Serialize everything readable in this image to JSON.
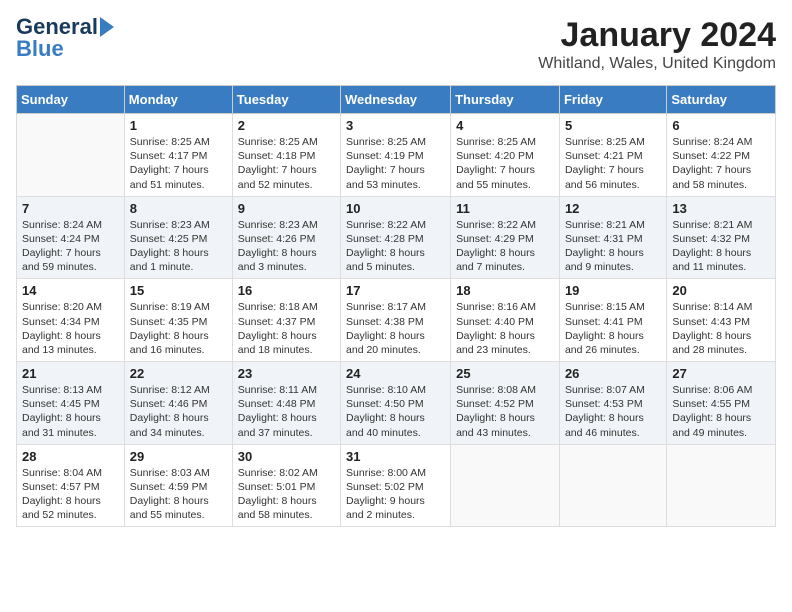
{
  "logo": {
    "text1": "General",
    "text2": "Blue"
  },
  "title": "January 2024",
  "location": "Whitland, Wales, United Kingdom",
  "days_of_week": [
    "Sunday",
    "Monday",
    "Tuesday",
    "Wednesday",
    "Thursday",
    "Friday",
    "Saturday"
  ],
  "weeks": [
    {
      "shaded": false,
      "days": [
        {
          "num": "",
          "sunrise": "",
          "sunset": "",
          "daylight": ""
        },
        {
          "num": "1",
          "sunrise": "Sunrise: 8:25 AM",
          "sunset": "Sunset: 4:17 PM",
          "daylight": "Daylight: 7 hours and 51 minutes."
        },
        {
          "num": "2",
          "sunrise": "Sunrise: 8:25 AM",
          "sunset": "Sunset: 4:18 PM",
          "daylight": "Daylight: 7 hours and 52 minutes."
        },
        {
          "num": "3",
          "sunrise": "Sunrise: 8:25 AM",
          "sunset": "Sunset: 4:19 PM",
          "daylight": "Daylight: 7 hours and 53 minutes."
        },
        {
          "num": "4",
          "sunrise": "Sunrise: 8:25 AM",
          "sunset": "Sunset: 4:20 PM",
          "daylight": "Daylight: 7 hours and 55 minutes."
        },
        {
          "num": "5",
          "sunrise": "Sunrise: 8:25 AM",
          "sunset": "Sunset: 4:21 PM",
          "daylight": "Daylight: 7 hours and 56 minutes."
        },
        {
          "num": "6",
          "sunrise": "Sunrise: 8:24 AM",
          "sunset": "Sunset: 4:22 PM",
          "daylight": "Daylight: 7 hours and 58 minutes."
        }
      ]
    },
    {
      "shaded": true,
      "days": [
        {
          "num": "7",
          "sunrise": "Sunrise: 8:24 AM",
          "sunset": "Sunset: 4:24 PM",
          "daylight": "Daylight: 7 hours and 59 minutes."
        },
        {
          "num": "8",
          "sunrise": "Sunrise: 8:23 AM",
          "sunset": "Sunset: 4:25 PM",
          "daylight": "Daylight: 8 hours and 1 minute."
        },
        {
          "num": "9",
          "sunrise": "Sunrise: 8:23 AM",
          "sunset": "Sunset: 4:26 PM",
          "daylight": "Daylight: 8 hours and 3 minutes."
        },
        {
          "num": "10",
          "sunrise": "Sunrise: 8:22 AM",
          "sunset": "Sunset: 4:28 PM",
          "daylight": "Daylight: 8 hours and 5 minutes."
        },
        {
          "num": "11",
          "sunrise": "Sunrise: 8:22 AM",
          "sunset": "Sunset: 4:29 PM",
          "daylight": "Daylight: 8 hours and 7 minutes."
        },
        {
          "num": "12",
          "sunrise": "Sunrise: 8:21 AM",
          "sunset": "Sunset: 4:31 PM",
          "daylight": "Daylight: 8 hours and 9 minutes."
        },
        {
          "num": "13",
          "sunrise": "Sunrise: 8:21 AM",
          "sunset": "Sunset: 4:32 PM",
          "daylight": "Daylight: 8 hours and 11 minutes."
        }
      ]
    },
    {
      "shaded": false,
      "days": [
        {
          "num": "14",
          "sunrise": "Sunrise: 8:20 AM",
          "sunset": "Sunset: 4:34 PM",
          "daylight": "Daylight: 8 hours and 13 minutes."
        },
        {
          "num": "15",
          "sunrise": "Sunrise: 8:19 AM",
          "sunset": "Sunset: 4:35 PM",
          "daylight": "Daylight: 8 hours and 16 minutes."
        },
        {
          "num": "16",
          "sunrise": "Sunrise: 8:18 AM",
          "sunset": "Sunset: 4:37 PM",
          "daylight": "Daylight: 8 hours and 18 minutes."
        },
        {
          "num": "17",
          "sunrise": "Sunrise: 8:17 AM",
          "sunset": "Sunset: 4:38 PM",
          "daylight": "Daylight: 8 hours and 20 minutes."
        },
        {
          "num": "18",
          "sunrise": "Sunrise: 8:16 AM",
          "sunset": "Sunset: 4:40 PM",
          "daylight": "Daylight: 8 hours and 23 minutes."
        },
        {
          "num": "19",
          "sunrise": "Sunrise: 8:15 AM",
          "sunset": "Sunset: 4:41 PM",
          "daylight": "Daylight: 8 hours and 26 minutes."
        },
        {
          "num": "20",
          "sunrise": "Sunrise: 8:14 AM",
          "sunset": "Sunset: 4:43 PM",
          "daylight": "Daylight: 8 hours and 28 minutes."
        }
      ]
    },
    {
      "shaded": true,
      "days": [
        {
          "num": "21",
          "sunrise": "Sunrise: 8:13 AM",
          "sunset": "Sunset: 4:45 PM",
          "daylight": "Daylight: 8 hours and 31 minutes."
        },
        {
          "num": "22",
          "sunrise": "Sunrise: 8:12 AM",
          "sunset": "Sunset: 4:46 PM",
          "daylight": "Daylight: 8 hours and 34 minutes."
        },
        {
          "num": "23",
          "sunrise": "Sunrise: 8:11 AM",
          "sunset": "Sunset: 4:48 PM",
          "daylight": "Daylight: 8 hours and 37 minutes."
        },
        {
          "num": "24",
          "sunrise": "Sunrise: 8:10 AM",
          "sunset": "Sunset: 4:50 PM",
          "daylight": "Daylight: 8 hours and 40 minutes."
        },
        {
          "num": "25",
          "sunrise": "Sunrise: 8:08 AM",
          "sunset": "Sunset: 4:52 PM",
          "daylight": "Daylight: 8 hours and 43 minutes."
        },
        {
          "num": "26",
          "sunrise": "Sunrise: 8:07 AM",
          "sunset": "Sunset: 4:53 PM",
          "daylight": "Daylight: 8 hours and 46 minutes."
        },
        {
          "num": "27",
          "sunrise": "Sunrise: 8:06 AM",
          "sunset": "Sunset: 4:55 PM",
          "daylight": "Daylight: 8 hours and 49 minutes."
        }
      ]
    },
    {
      "shaded": false,
      "days": [
        {
          "num": "28",
          "sunrise": "Sunrise: 8:04 AM",
          "sunset": "Sunset: 4:57 PM",
          "daylight": "Daylight: 8 hours and 52 minutes."
        },
        {
          "num": "29",
          "sunrise": "Sunrise: 8:03 AM",
          "sunset": "Sunset: 4:59 PM",
          "daylight": "Daylight: 8 hours and 55 minutes."
        },
        {
          "num": "30",
          "sunrise": "Sunrise: 8:02 AM",
          "sunset": "Sunset: 5:01 PM",
          "daylight": "Daylight: 8 hours and 58 minutes."
        },
        {
          "num": "31",
          "sunrise": "Sunrise: 8:00 AM",
          "sunset": "Sunset: 5:02 PM",
          "daylight": "Daylight: 9 hours and 2 minutes."
        },
        {
          "num": "",
          "sunrise": "",
          "sunset": "",
          "daylight": ""
        },
        {
          "num": "",
          "sunrise": "",
          "sunset": "",
          "daylight": ""
        },
        {
          "num": "",
          "sunrise": "",
          "sunset": "",
          "daylight": ""
        }
      ]
    }
  ]
}
